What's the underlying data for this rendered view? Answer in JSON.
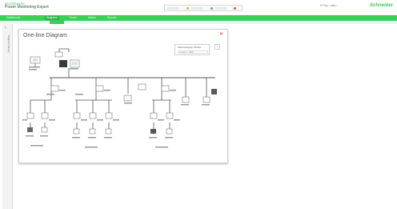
{
  "header": {
    "brand_top": "EcoStruxure",
    "brand_bottom": "Power Monitoring Expert",
    "user": "S Roy   • user   •",
    "logo": "Schneider"
  },
  "nav": {
    "items": [
      "Dashboards",
      "Diagrams",
      "Trends",
      "Alarms",
      "Reports"
    ]
  },
  "sidebar": {
    "toggle": "‹",
    "label": "Diagram Library"
  },
  "card": {
    "title": "One-line Diagram",
    "close_icon": "close-icon",
    "legend_title": "Select Diagram Version",
    "legend_value": "Version 1 · 2020",
    "legend_button": "⋮"
  },
  "colors": {
    "accent": "#3dcd58",
    "close": "#e0321e"
  }
}
